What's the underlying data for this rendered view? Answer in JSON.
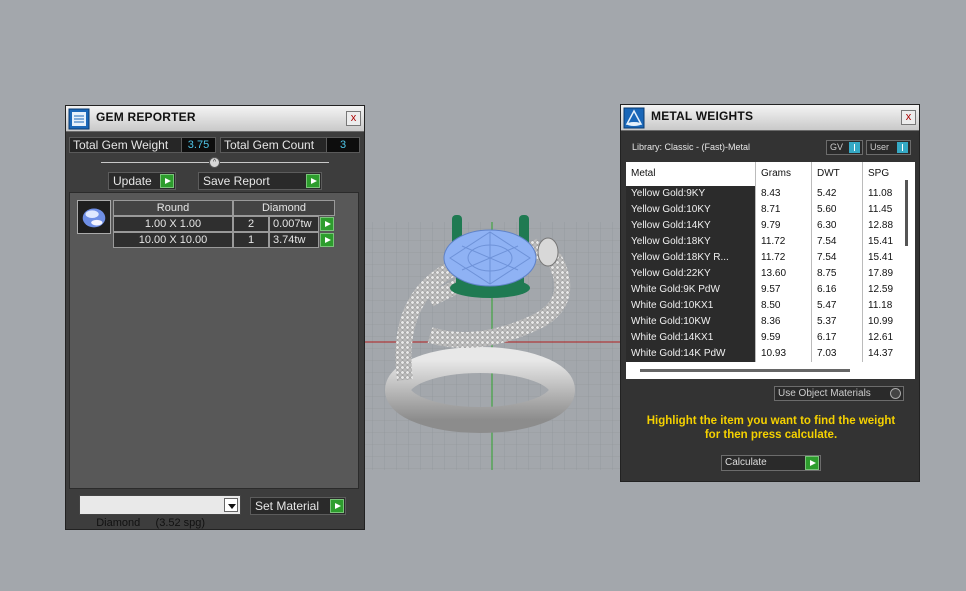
{
  "colors": {
    "accent_value": "#4fc6e8",
    "go_green": "#2d9d2d",
    "hint_yellow": "#f5d100",
    "toggle_blue": "#35a9c5"
  },
  "gem_reporter": {
    "title": "GEM REPORTER",
    "close_label": "x",
    "total_weight_label": "Total Gem Weight",
    "total_weight_value": "3.75",
    "total_count_label": "Total Gem Count",
    "total_count_value": "3",
    "update_label": "Update",
    "save_report_label": "Save Report",
    "list": {
      "shape_header": "Round",
      "material_header": "Diamond",
      "rows": [
        {
          "size": "1.00 X 1.00",
          "count": "2",
          "weight": "0.007tw"
        },
        {
          "size": "10.00 X 10.00",
          "count": "1",
          "weight": "3.74tw"
        }
      ]
    },
    "material_select_value": "Diamond     (3.52 spg)",
    "set_material_label": "Set Material",
    "icon": "gem-reporter-icon"
  },
  "metal_weights": {
    "title": "METAL WEIGHTS",
    "close_label": "x",
    "library_label": "Library: Classic - (Fast)-Metal",
    "gv_label": "GV",
    "user_label": "User",
    "columns": [
      "Metal",
      "Grams",
      "DWT",
      "SPG"
    ],
    "rows": [
      [
        "Yellow Gold:9KY",
        "8.43",
        "5.42",
        "11.08"
      ],
      [
        "Yellow Gold:10KY",
        "8.71",
        "5.60",
        "11.45"
      ],
      [
        "Yellow Gold:14KY",
        "9.79",
        "6.30",
        "12.88"
      ],
      [
        "Yellow Gold:18KY",
        "11.72",
        "7.54",
        "15.41"
      ],
      [
        "Yellow Gold:18KY R...",
        "11.72",
        "7.54",
        "15.41"
      ],
      [
        "Yellow Gold:22KY",
        "13.60",
        "8.75",
        "17.89"
      ],
      [
        "White Gold:9K PdW",
        "9.57",
        "6.16",
        "12.59"
      ],
      [
        "White Gold:10KX1",
        "8.50",
        "5.47",
        "11.18"
      ],
      [
        "White Gold:10KW",
        "8.36",
        "5.37",
        "10.99"
      ],
      [
        "White Gold:14KX1",
        "9.59",
        "6.17",
        "12.61"
      ],
      [
        "White Gold:14K PdW",
        "10.93",
        "7.03",
        "14.37"
      ]
    ],
    "use_object_materials_label": "Use Object Materials",
    "hint_line1": "Highlight the item you want to find the weight",
    "hint_line2": "for then press calculate.",
    "calculate_label": "Calculate",
    "icon": "metal-weights-icon"
  }
}
